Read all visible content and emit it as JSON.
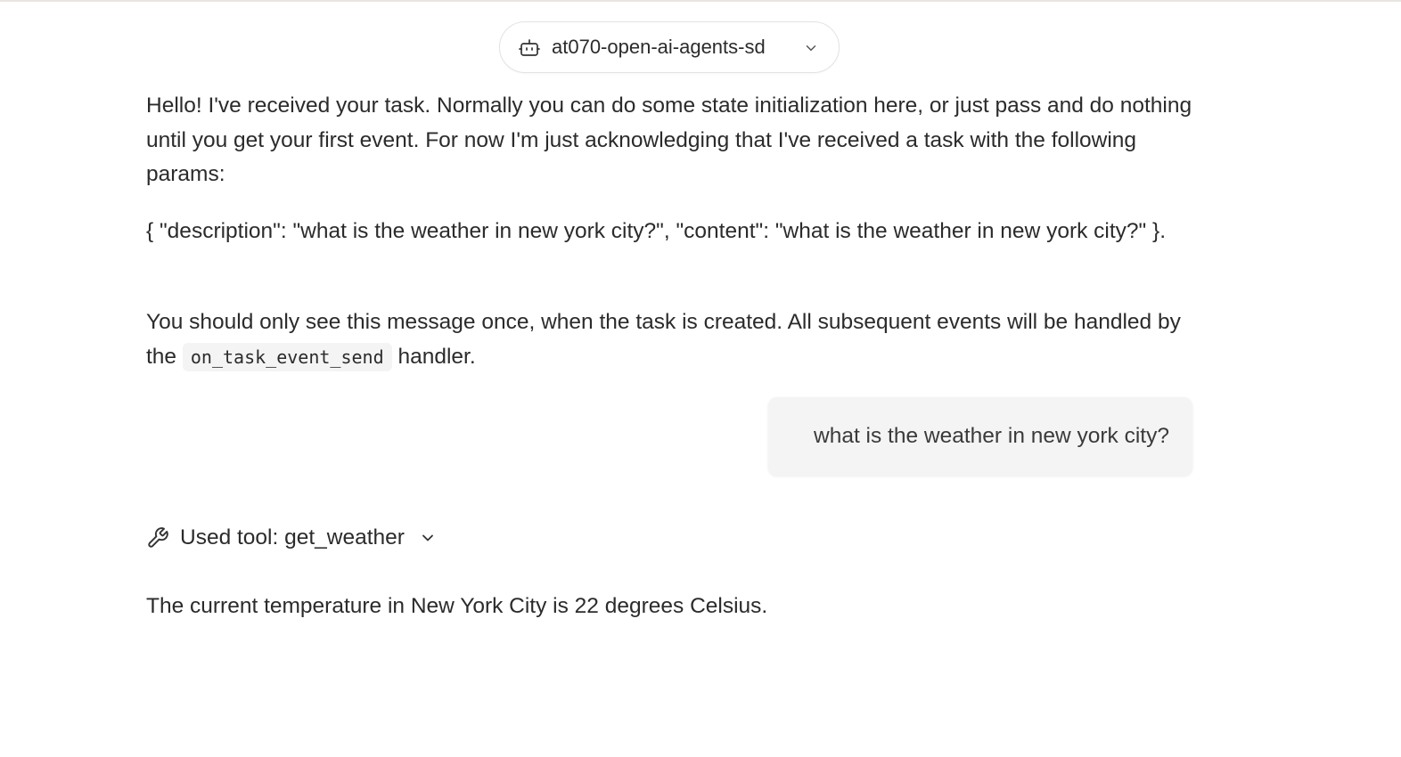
{
  "agent_selector": {
    "name": "at070-open-ai-agents-sd",
    "icon": "bot-icon",
    "dropdown_icon": "chevron-down-icon"
  },
  "messages": {
    "intro": {
      "text": "Hello! I've received your task. Normally you can do some state initialization here, or just pass and do nothing until you get your first event. For now I'm just acknowledging that I've received a task with the following params:"
    },
    "params": {
      "text": "{ \"description\": \"what is the weather in new york city?\", \"content\": \"what is the weather in new york city?\" }."
    },
    "notice": {
      "before": "You should only see this message once, when the task is created. All subsequent events will be handled by the",
      "code": "on_task_event_send",
      "after": "handler."
    },
    "user_message": {
      "text": "what is the weather in new york city?"
    },
    "tool_use": {
      "label": "Used tool: get_weather",
      "icon": "wrench-icon",
      "expand_icon": "chevron-down-icon"
    },
    "answer": {
      "text": "The current temperature in New York City is 22 degrees Celsius."
    }
  },
  "colors": {
    "text": "#2b2b2b",
    "bubble_bg": "#f4f4f4",
    "border": "#e3e3e3",
    "top_rule": "#e9e6e1"
  }
}
